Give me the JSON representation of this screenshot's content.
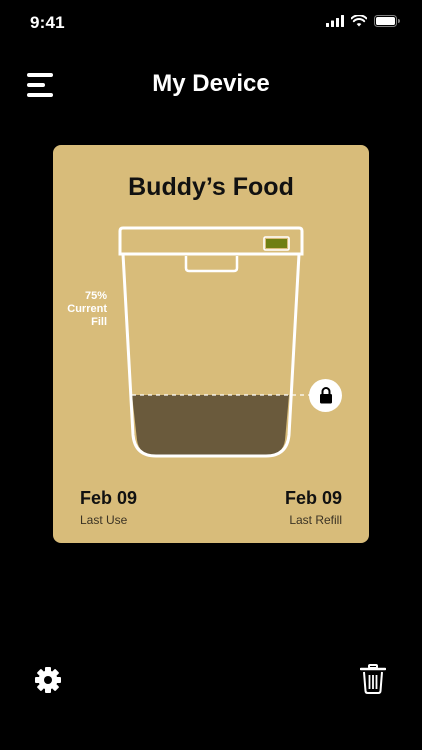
{
  "status_bar": {
    "time": "9:41",
    "icons": [
      "cellular-signal-icon",
      "wifi-icon",
      "battery-icon"
    ]
  },
  "header": {
    "title": "My Device",
    "menu_icon": "hamburger-menu-icon"
  },
  "card": {
    "title": "Buddy’s Food",
    "fill": {
      "percent_text": "75%",
      "label_line1": "Current",
      "label_line2": "Fill",
      "level_shown": 0.3
    },
    "battery_indicator_color": "#6f7f12",
    "food_color": "#6a5a3c",
    "last_use": {
      "date": "Feb 09",
      "label": "Last Use"
    },
    "last_refill": {
      "date": "Feb 09",
      "label": "Last Refill"
    },
    "lock_icon": "lock-icon"
  },
  "footer": {
    "settings_icon": "gear-icon",
    "delete_icon": "trash-icon"
  },
  "colors": {
    "background": "#000000",
    "card": "#d8bc7a",
    "text_dark": "#111111"
  }
}
